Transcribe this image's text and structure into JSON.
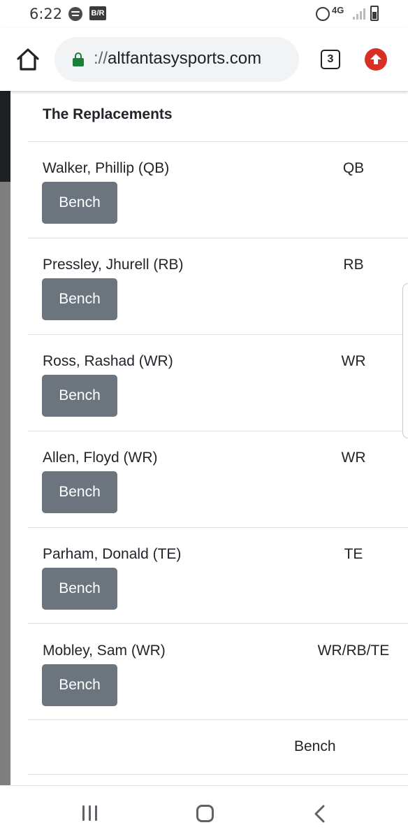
{
  "status_bar": {
    "time": "6:22",
    "app_icons": [
      "spotify-icon",
      "bleacher-report-icon"
    ],
    "network": "4G",
    "system_icons": [
      "alarm-icon",
      "network-4g-icon",
      "signal-icon",
      "battery-charging-icon"
    ]
  },
  "browser": {
    "url_scheme": "://",
    "url_host": "altfantasysports.com",
    "tab_count": "3",
    "icons": [
      "home-icon",
      "lock-icon",
      "tabs-icon",
      "update-icon"
    ],
    "colors": {
      "lock": "#188038",
      "update": "#d93025"
    }
  },
  "page": {
    "team_name": "The Replacements",
    "players": [
      {
        "name": "Walker, Phillip (QB)",
        "position": "QB",
        "button": "Bench"
      },
      {
        "name": "Pressley, Jhurell (RB)",
        "position": "RB",
        "button": "Bench"
      },
      {
        "name": "Ross, Rashad (WR)",
        "position": "WR",
        "button": "Bench"
      },
      {
        "name": "Allen, Floyd (WR)",
        "position": "WR",
        "button": "Bench"
      },
      {
        "name": "Parham, Donald (TE)",
        "position": "TE",
        "button": "Bench"
      },
      {
        "name": "Mobley, Sam (WR)",
        "position": "WR/RB/TE",
        "button": "Bench"
      }
    ],
    "bench_label": "Bench",
    "colors": {
      "button": "#6c757d",
      "sidebar_top": "#1d2124",
      "sidebar": "#7f7f7f"
    }
  },
  "nav_bar": {
    "icons": [
      "recents-icon",
      "home-circle-icon",
      "back-icon"
    ]
  }
}
